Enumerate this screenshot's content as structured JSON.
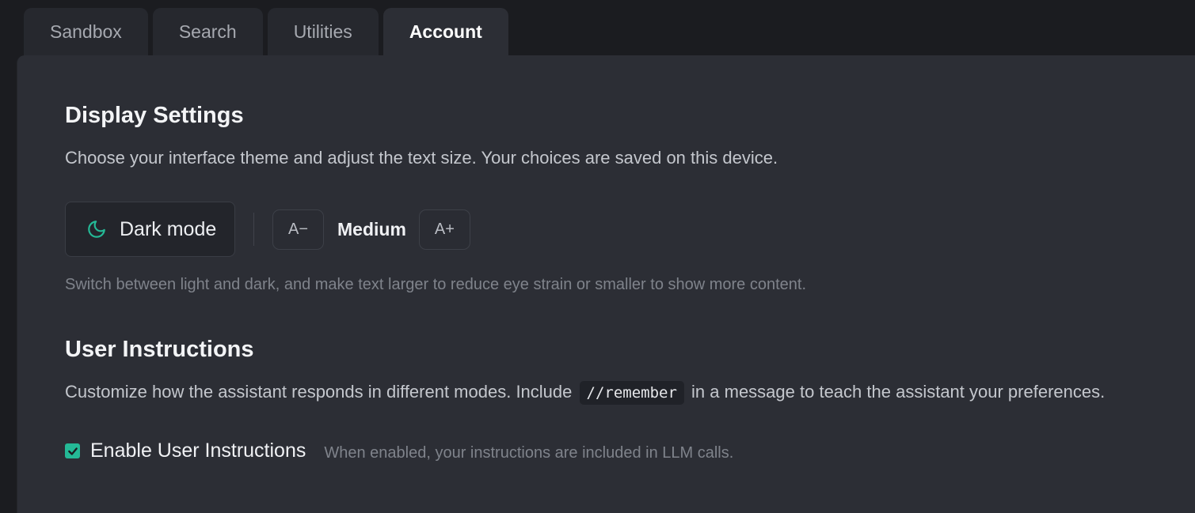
{
  "tabs": [
    {
      "label": "Sandbox",
      "active": false
    },
    {
      "label": "Search",
      "active": false
    },
    {
      "label": "Utilities",
      "active": false
    },
    {
      "label": "Account",
      "active": true
    }
  ],
  "display_settings": {
    "title": "Display Settings",
    "description": "Choose your interface theme and adjust the text size. Your choices are saved on this device.",
    "theme_button": {
      "label": "Dark mode",
      "icon": "moon-icon"
    },
    "text_size": {
      "decrease_label": "A−",
      "current": "Medium",
      "increase_label": "A+"
    },
    "hint": "Switch between light and dark, and make text larger to reduce eye strain or smaller to show more content."
  },
  "user_instructions": {
    "title": "User Instructions",
    "description_before": "Customize how the assistant responds in different modes. Include",
    "code": "//remember",
    "description_after": "in a message to teach the assistant your preferences.",
    "enable": {
      "label": "Enable User Instructions",
      "checked": true,
      "hint": "When enabled, your instructions are included in LLM calls."
    }
  },
  "colors": {
    "accent": "#24b996",
    "panel_bg": "#2c2e35",
    "page_bg": "#1b1c20"
  }
}
